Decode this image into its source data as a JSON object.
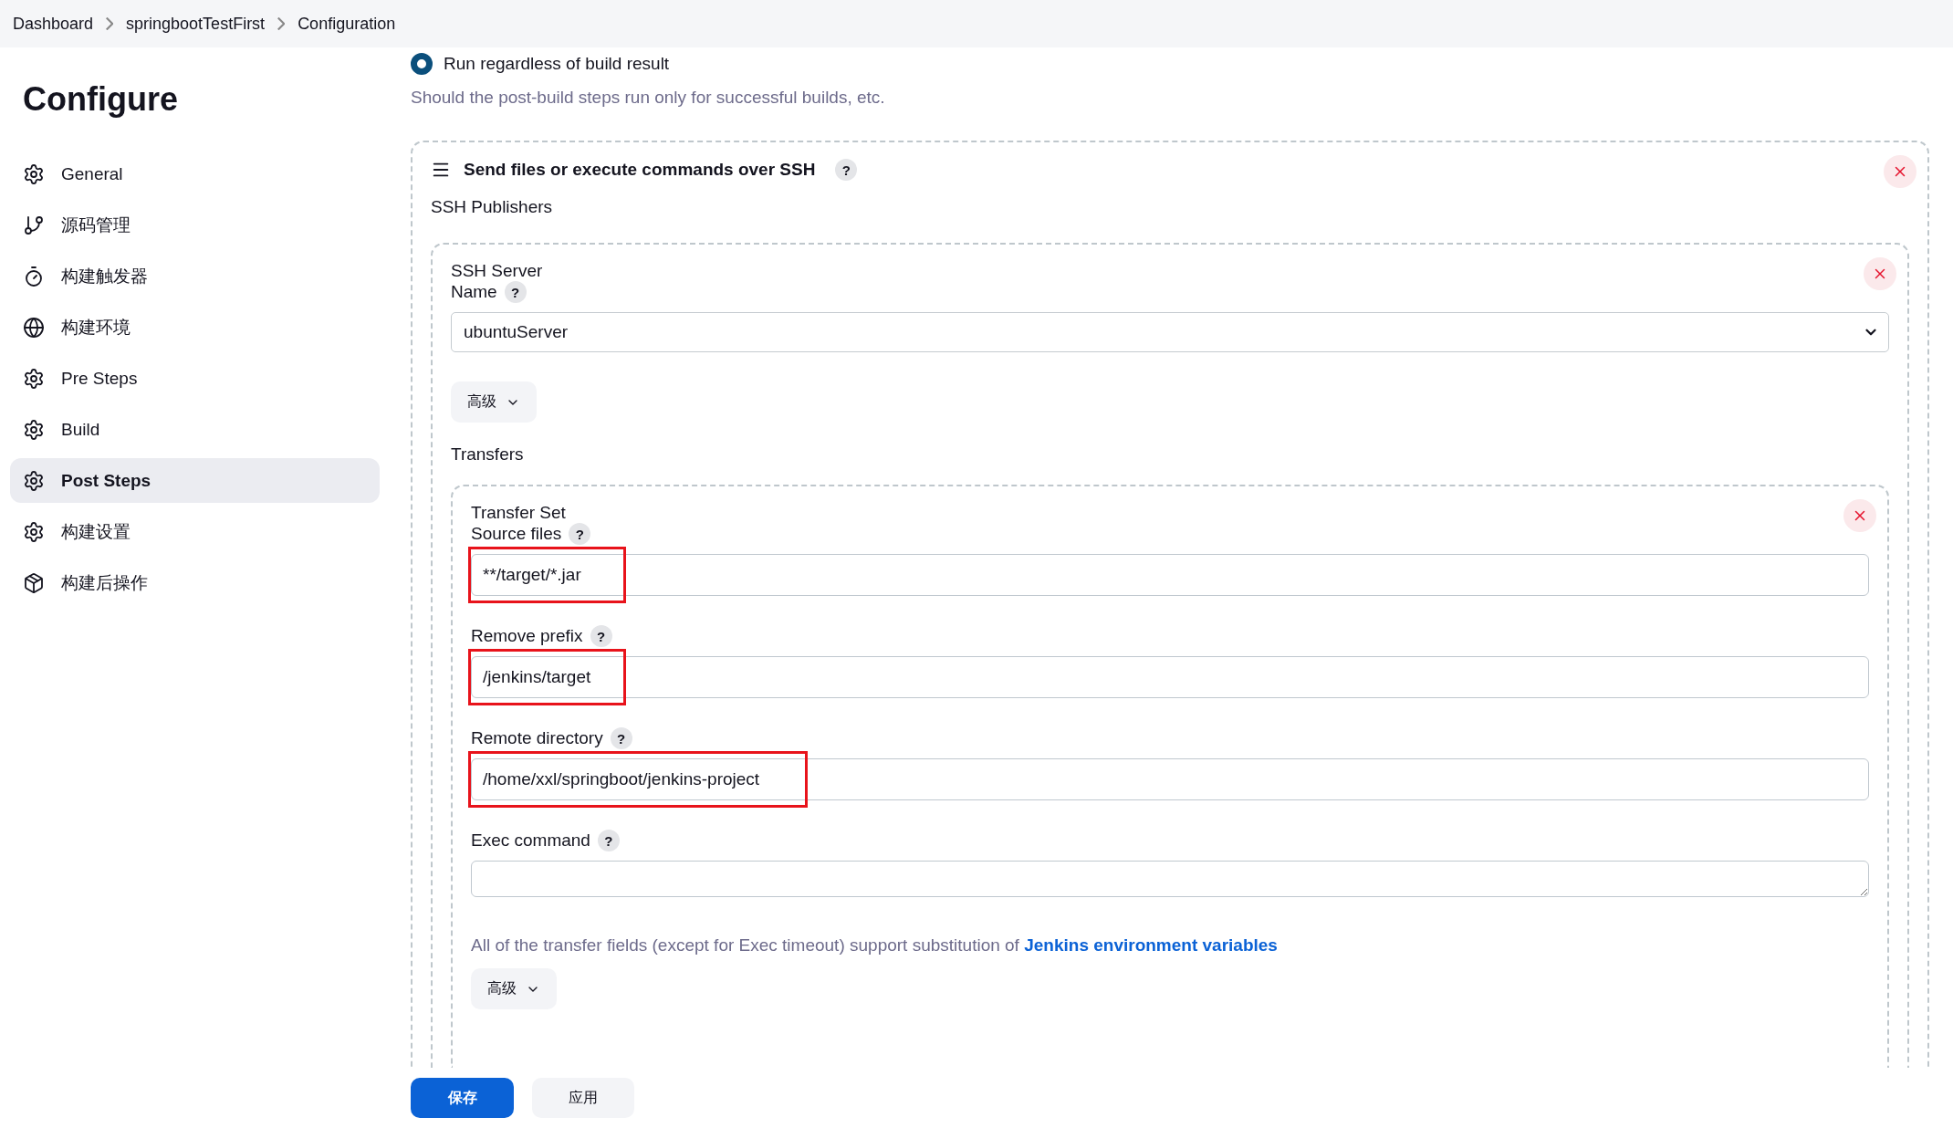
{
  "breadcrumbs": [
    "Dashboard",
    "springbootTestFirst",
    "Configuration"
  ],
  "page_title": "Configure",
  "sidebar": {
    "items": [
      {
        "label": "General",
        "kind": "settings",
        "selected": false
      },
      {
        "label": "源码管理",
        "kind": "source",
        "selected": false
      },
      {
        "label": "构建触发器",
        "kind": "trigger",
        "selected": false
      },
      {
        "label": "构建环境",
        "kind": "environment",
        "selected": false
      },
      {
        "label": "Pre Steps",
        "kind": "settings",
        "selected": false
      },
      {
        "label": "Build",
        "kind": "settings",
        "selected": false
      },
      {
        "label": "Post Steps",
        "kind": "settings",
        "selected": true
      },
      {
        "label": "构建设置",
        "kind": "settings",
        "selected": false
      },
      {
        "label": "构建后操作",
        "kind": "postbuild",
        "selected": false
      }
    ]
  },
  "post_build": {
    "radio": {
      "label": "Run regardless of build result",
      "selected": true
    },
    "description": "Should the post-build steps run only for successful builds, etc."
  },
  "ssh_section": {
    "title": "Send files or execute commands over SSH",
    "help": "?",
    "subtitle": "SSH Publishers",
    "server": {
      "heading": "SSH Server",
      "name_label": "Name",
      "help": "?",
      "name_value": "ubuntuServer",
      "advanced_button": "高级"
    },
    "transfers_label": "Transfers",
    "transfer_set": {
      "heading": "Transfer Set",
      "fields": [
        {
          "label": "Source files",
          "help": "?",
          "value": "**/target/*.jar",
          "kind": "input",
          "highlighted": true
        },
        {
          "label": "Remove prefix",
          "help": "?",
          "value": "/jenkins/target",
          "kind": "input",
          "highlighted": true
        },
        {
          "label": "Remote directory",
          "help": "?",
          "value": "/home/xxl/springboot/jenkins-project",
          "kind": "input",
          "highlighted": true
        },
        {
          "label": "Exec command",
          "help": "?",
          "kind": "textarea"
        }
      ],
      "note": "All of the transfer fields (except for Exec timeout) support substitution of",
      "note_link": "Jenkins environment variables",
      "advanced_button": "高级"
    }
  },
  "buttons": [
    {
      "label": "保存",
      "kind": "primary"
    },
    {
      "label": "应用",
      "kind": "secondary"
    }
  ]
}
